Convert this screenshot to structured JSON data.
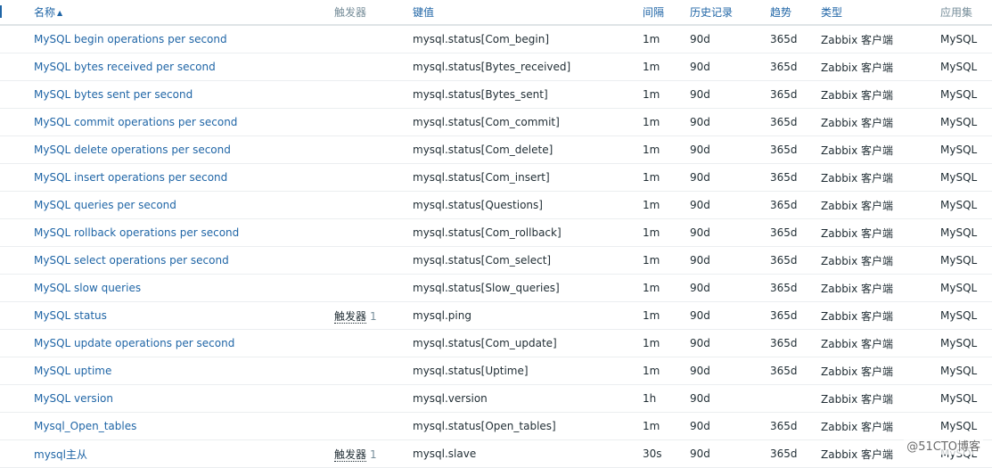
{
  "headers": {
    "name": "名称",
    "triggers": "触发器",
    "key": "键值",
    "interval": "间隔",
    "history": "历史记录",
    "trends": "趋势",
    "type": "类型",
    "applications": "应用集"
  },
  "sort_arrow": "▲",
  "rows": [
    {
      "name": "MySQL begin operations per second",
      "trigger_label": "",
      "trigger_count": "",
      "key": "mysql.status[Com_begin]",
      "interval": "1m",
      "history": "90d",
      "trends": "365d",
      "type": "Zabbix 客户端",
      "app": "MySQL"
    },
    {
      "name": "MySQL bytes received per second",
      "trigger_label": "",
      "trigger_count": "",
      "key": "mysql.status[Bytes_received]",
      "interval": "1m",
      "history": "90d",
      "trends": "365d",
      "type": "Zabbix 客户端",
      "app": "MySQL"
    },
    {
      "name": "MySQL bytes sent per second",
      "trigger_label": "",
      "trigger_count": "",
      "key": "mysql.status[Bytes_sent]",
      "interval": "1m",
      "history": "90d",
      "trends": "365d",
      "type": "Zabbix 客户端",
      "app": "MySQL"
    },
    {
      "name": "MySQL commit operations per second",
      "trigger_label": "",
      "trigger_count": "",
      "key": "mysql.status[Com_commit]",
      "interval": "1m",
      "history": "90d",
      "trends": "365d",
      "type": "Zabbix 客户端",
      "app": "MySQL"
    },
    {
      "name": "MySQL delete operations per second",
      "trigger_label": "",
      "trigger_count": "",
      "key": "mysql.status[Com_delete]",
      "interval": "1m",
      "history": "90d",
      "trends": "365d",
      "type": "Zabbix 客户端",
      "app": "MySQL"
    },
    {
      "name": "MySQL insert operations per second",
      "trigger_label": "",
      "trigger_count": "",
      "key": "mysql.status[Com_insert]",
      "interval": "1m",
      "history": "90d",
      "trends": "365d",
      "type": "Zabbix 客户端",
      "app": "MySQL"
    },
    {
      "name": "MySQL queries per second",
      "trigger_label": "",
      "trigger_count": "",
      "key": "mysql.status[Questions]",
      "interval": "1m",
      "history": "90d",
      "trends": "365d",
      "type": "Zabbix 客户端",
      "app": "MySQL"
    },
    {
      "name": "MySQL rollback operations per second",
      "trigger_label": "",
      "trigger_count": "",
      "key": "mysql.status[Com_rollback]",
      "interval": "1m",
      "history": "90d",
      "trends": "365d",
      "type": "Zabbix 客户端",
      "app": "MySQL"
    },
    {
      "name": "MySQL select operations per second",
      "trigger_label": "",
      "trigger_count": "",
      "key": "mysql.status[Com_select]",
      "interval": "1m",
      "history": "90d",
      "trends": "365d",
      "type": "Zabbix 客户端",
      "app": "MySQL"
    },
    {
      "name": "MySQL slow queries",
      "trigger_label": "",
      "trigger_count": "",
      "key": "mysql.status[Slow_queries]",
      "interval": "1m",
      "history": "90d",
      "trends": "365d",
      "type": "Zabbix 客户端",
      "app": "MySQL"
    },
    {
      "name": "MySQL status",
      "trigger_label": "触发器",
      "trigger_count": "1",
      "key": "mysql.ping",
      "interval": "1m",
      "history": "90d",
      "trends": "365d",
      "type": "Zabbix 客户端",
      "app": "MySQL"
    },
    {
      "name": "MySQL update operations per second",
      "trigger_label": "",
      "trigger_count": "",
      "key": "mysql.status[Com_update]",
      "interval": "1m",
      "history": "90d",
      "trends": "365d",
      "type": "Zabbix 客户端",
      "app": "MySQL"
    },
    {
      "name": "MySQL uptime",
      "trigger_label": "",
      "trigger_count": "",
      "key": "mysql.status[Uptime]",
      "interval": "1m",
      "history": "90d",
      "trends": "365d",
      "type": "Zabbix 客户端",
      "app": "MySQL"
    },
    {
      "name": "MySQL version",
      "trigger_label": "",
      "trigger_count": "",
      "key": "mysql.version",
      "interval": "1h",
      "history": "90d",
      "trends": "",
      "type": "Zabbix 客户端",
      "app": "MySQL"
    },
    {
      "name": "Mysql_Open_tables",
      "trigger_label": "",
      "trigger_count": "",
      "key": "mysql.status[Open_tables]",
      "interval": "1m",
      "history": "90d",
      "trends": "365d",
      "type": "Zabbix 客户端",
      "app": "MySQL"
    },
    {
      "name": "mysql主从",
      "trigger_label": "触发器",
      "trigger_count": "1",
      "key": "mysql.slave",
      "interval": "30s",
      "history": "90d",
      "trends": "365d",
      "type": "Zabbix 客户端",
      "app": "MySQL"
    }
  ],
  "watermark": "@51CTO博客",
  "colors": {
    "link": "#1f65a6",
    "header_muted": "#768d99",
    "text": "#1f2c33",
    "row_border": "#ebeef0"
  }
}
